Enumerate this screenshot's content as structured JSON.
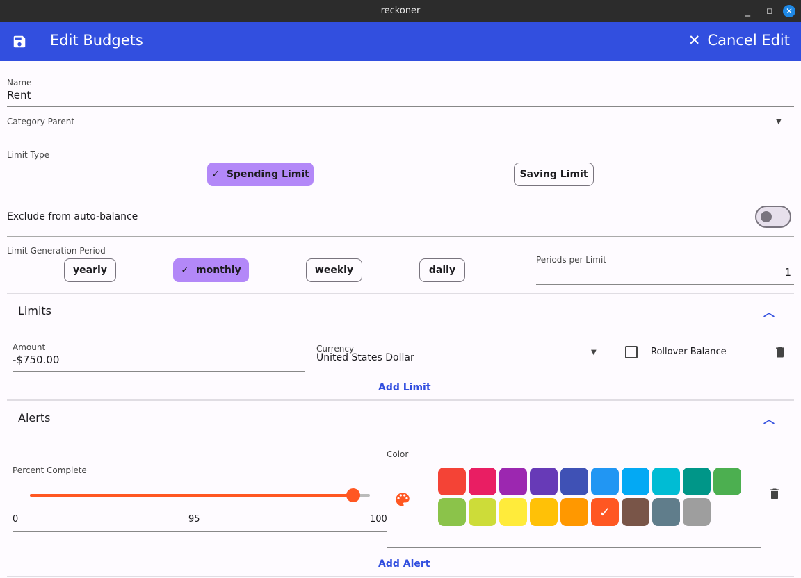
{
  "window": {
    "title": "reckoner"
  },
  "appbar": {
    "title": "Edit Budgets",
    "cancel_label": "Cancel Edit"
  },
  "form": {
    "name_label": "Name",
    "name_value": "Rent",
    "category_parent_label": "Category Parent",
    "category_parent_value": "",
    "limit_type_label": "Limit Type",
    "limit_types": [
      {
        "label": "Spending Limit",
        "selected": true
      },
      {
        "label": "Saving Limit",
        "selected": false
      }
    ],
    "exclude_label": "Exclude from auto-balance",
    "exclude_value": false,
    "period_label": "Limit Generation Period",
    "periods": [
      {
        "label": "yearly",
        "selected": false
      },
      {
        "label": "monthly",
        "selected": true
      },
      {
        "label": "weekly",
        "selected": false
      },
      {
        "label": "daily",
        "selected": false
      }
    ],
    "periods_per_limit_label": "Periods per Limit",
    "periods_per_limit_value": "1"
  },
  "limits": {
    "title": "Limits",
    "amount_label": "Amount",
    "amount_value": "-$750.00",
    "currency_label": "Currency",
    "currency_value": "United States Dollar",
    "rollover_label": "Rollover Balance",
    "rollover_checked": false,
    "add_label": "Add Limit"
  },
  "alerts": {
    "title": "Alerts",
    "percent_label": "Percent Complete",
    "slider_min": "0",
    "slider_value": "95",
    "slider_max": "100",
    "color_label": "Color",
    "accent": "#ff5722",
    "colors": [
      "#f44336",
      "#e91e63",
      "#9c27b0",
      "#673ab7",
      "#3f51b5",
      "#2196f3",
      "#03a9f4",
      "#00bcd4",
      "#009688",
      "#4caf50",
      "#8bc34a",
      "#cddc39",
      "#ffeb3b",
      "#ffc107",
      "#ff9800",
      "#ff5722",
      "#795548",
      "#607d8b",
      "#9e9e9e"
    ],
    "selected_color": "#ff5722",
    "add_label": "Add Alert"
  }
}
